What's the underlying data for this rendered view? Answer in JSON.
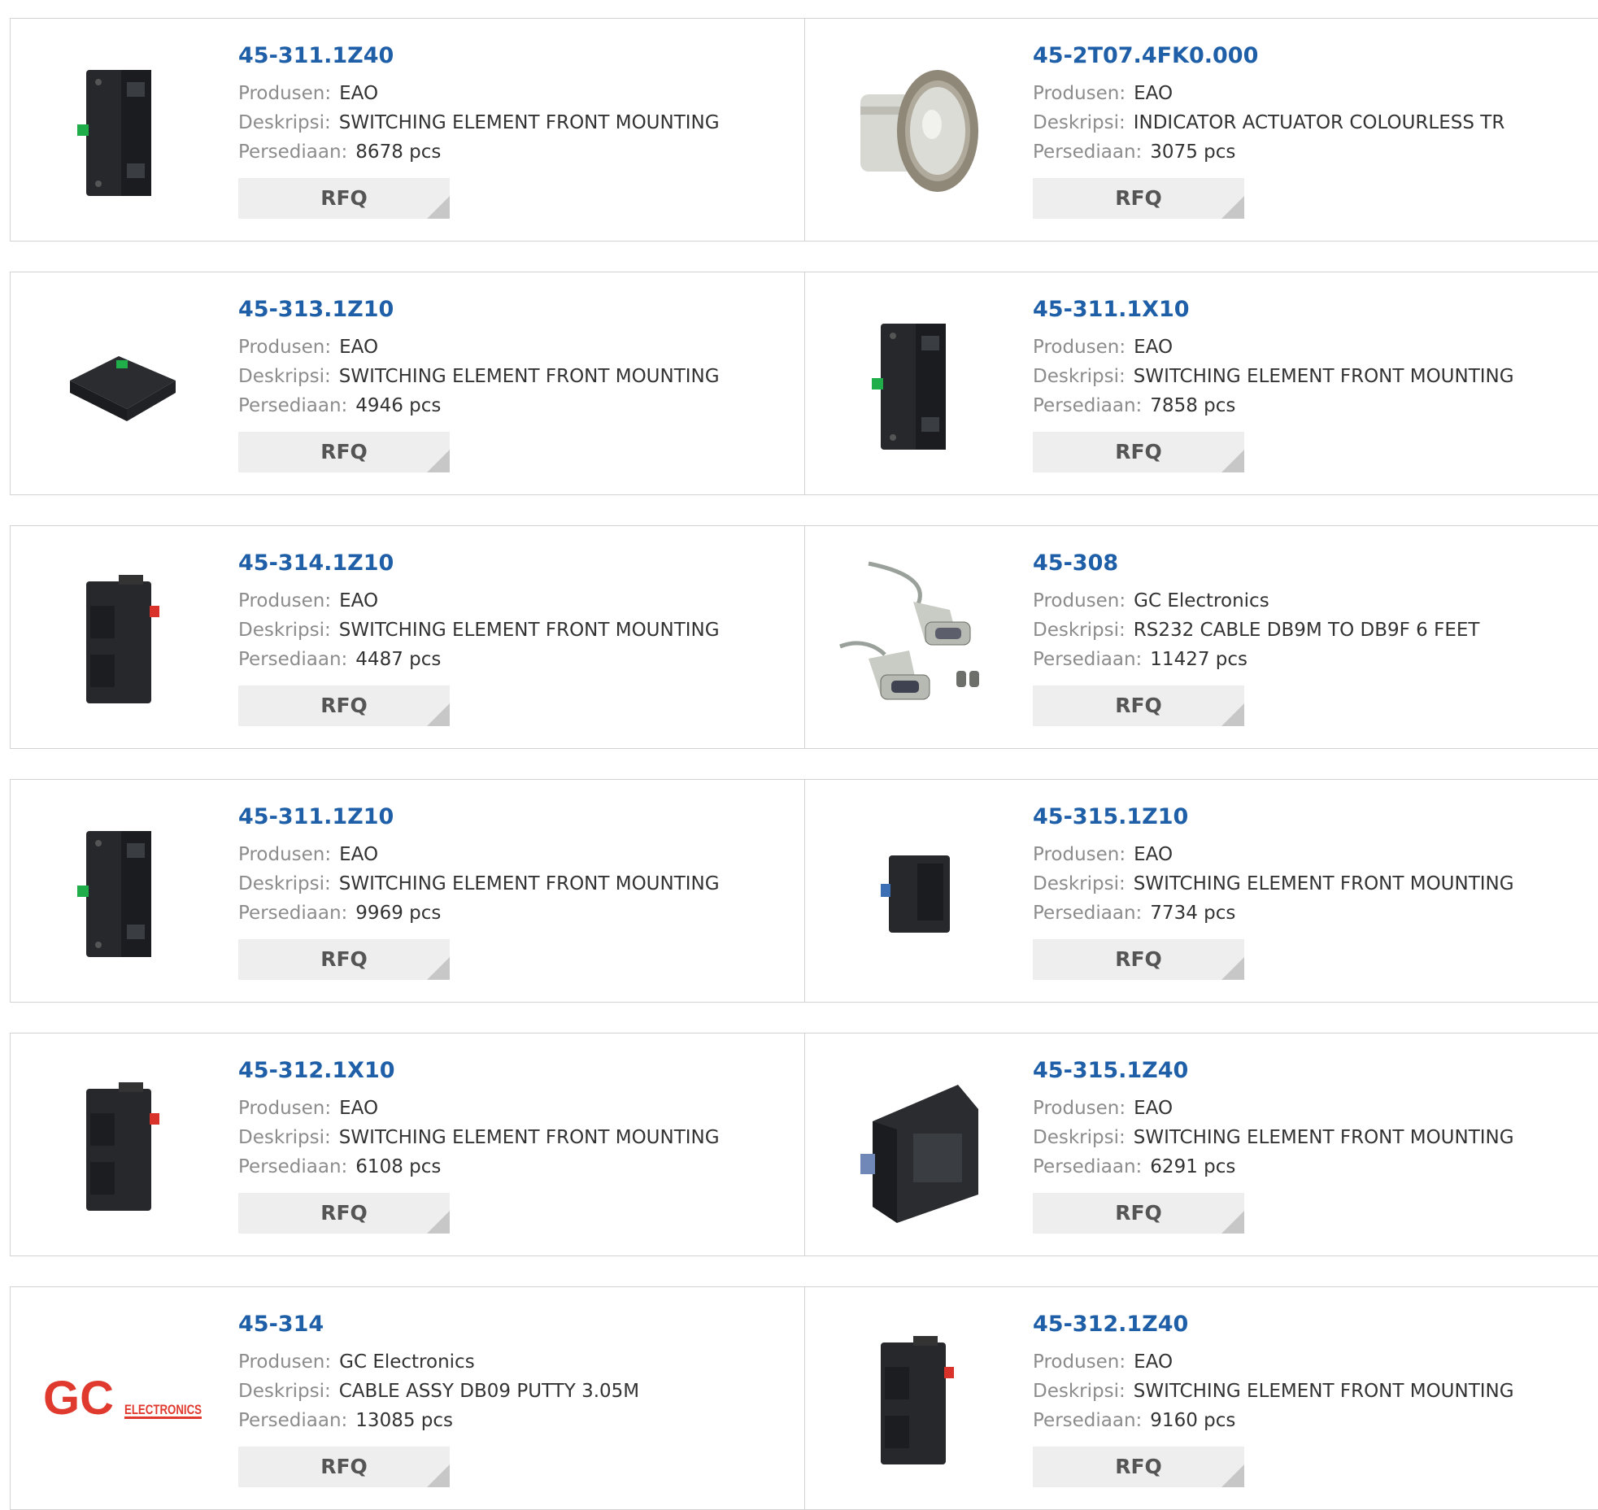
{
  "labels": {
    "manufacturer": "Produsen:",
    "description": "Deskripsi:",
    "stock": "Persediaan:",
    "rfq": "RFQ"
  },
  "products": [
    {
      "part": "45-311.1Z40",
      "manufacturer": "EAO",
      "description": "SWITCHING ELEMENT FRONT MOUNTING",
      "stock": "8678 pcs",
      "image": "switch-block-green-icon"
    },
    {
      "part": "45-2T07.4FK0.000",
      "manufacturer": "EAO",
      "description": "INDICATOR ACTUATOR COLOURLESS TR",
      "stock": "3075 pcs",
      "image": "indicator-actuator-icon"
    },
    {
      "part": "45-313.1Z10",
      "manufacturer": "EAO",
      "description": "SWITCHING ELEMENT FRONT MOUNTING",
      "stock": "4946 pcs",
      "image": "switch-block-flat-icon"
    },
    {
      "part": "45-311.1X10",
      "manufacturer": "EAO",
      "description": "SWITCHING ELEMENT FRONT MOUNTING",
      "stock": "7858 pcs",
      "image": "switch-block-green-icon"
    },
    {
      "part": "45-314.1Z10",
      "manufacturer": "EAO",
      "description": "SWITCHING ELEMENT FRONT MOUNTING",
      "stock": "4487 pcs",
      "image": "switch-block-red-icon"
    },
    {
      "part": "45-308",
      "manufacturer": "GC Electronics",
      "description": "RS232 CABLE DB9M TO DB9F 6 FEET",
      "stock": "11427 pcs",
      "image": "db9-cable-icon"
    },
    {
      "part": "45-311.1Z10",
      "manufacturer": "EAO",
      "description": "SWITCHING ELEMENT FRONT MOUNTING",
      "stock": "9969 pcs",
      "image": "switch-block-green-icon"
    },
    {
      "part": "45-315.1Z10",
      "manufacturer": "EAO",
      "description": "SWITCHING ELEMENT FRONT MOUNTING",
      "stock": "7734 pcs",
      "image": "switch-block-small-icon"
    },
    {
      "part": "45-312.1X10",
      "manufacturer": "EAO",
      "description": "SWITCHING ELEMENT FRONT MOUNTING",
      "stock": "6108 pcs",
      "image": "switch-block-red-icon"
    },
    {
      "part": "45-315.1Z40",
      "manufacturer": "EAO",
      "description": "SWITCHING ELEMENT FRONT MOUNTING",
      "stock": "6291 pcs",
      "image": "switch-block-wide-icon"
    },
    {
      "part": "45-314",
      "manufacturer": "GC Electronics",
      "description": "CABLE ASSY DB09 PUTTY 3.05M",
      "stock": "13085 pcs",
      "image": "gc-electronics-logo"
    },
    {
      "part": "45-312.1Z40",
      "manufacturer": "EAO",
      "description": "SWITCHING ELEMENT FRONT MOUNTING",
      "stock": "9160 pcs",
      "image": "switch-block-red-icon"
    }
  ],
  "logo_text": {
    "brand": "GC",
    "sub": "ELECTRONICS"
  },
  "colors": {
    "part_link": "#1f5fa8",
    "label": "#8c8c8c",
    "value": "#333333",
    "border": "#d3d3d3",
    "rfq_bg": "#eeeeee",
    "logo_red": "#e03a2f"
  }
}
